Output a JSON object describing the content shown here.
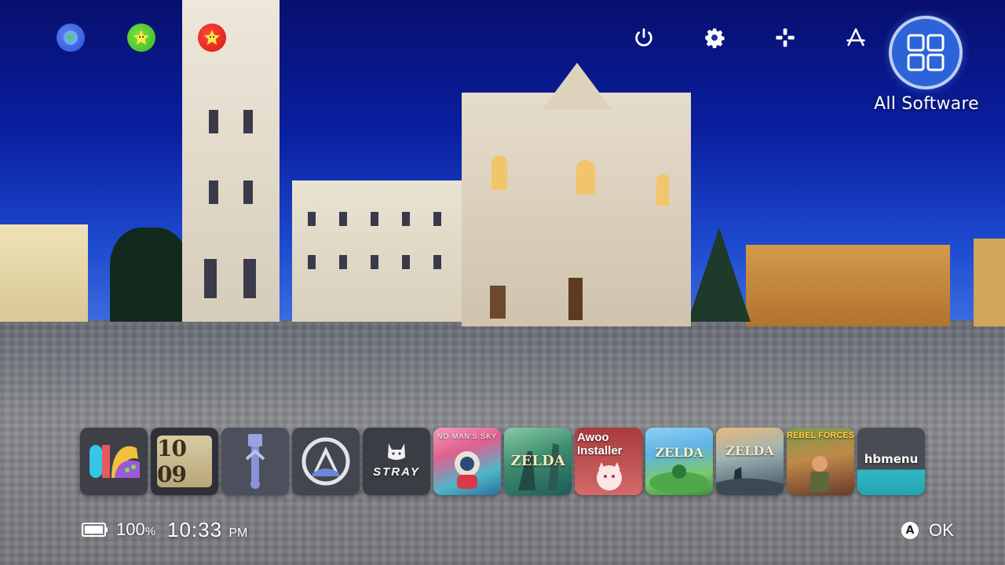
{
  "top_icons": [
    {
      "name": "globe-icon"
    },
    {
      "name": "green-star-icon"
    },
    {
      "name": "red-star-icon"
    }
  ],
  "system_icons": [
    "power-icon",
    "settings-gear-icon",
    "controllers-icon",
    "app-store-icon"
  ],
  "all_software": {
    "label": "All Software",
    "icon": "grid-icon",
    "ring_color": "#2c63d8"
  },
  "tiles": [
    {
      "id": "palette",
      "icon": "joycon-palette-icon"
    },
    {
      "id": "clock",
      "text": "10 09"
    },
    {
      "id": "usb",
      "icon": "usb-icon"
    },
    {
      "id": "cloud-sync",
      "icon": "sync-circle-icon"
    },
    {
      "id": "stray",
      "text": "STRAY"
    },
    {
      "id": "no-mans-sky",
      "text": "NO MAN'S SKY"
    },
    {
      "id": "zelda-1",
      "text": "ZELDA"
    },
    {
      "id": "awoo",
      "text": "Awoo Installer"
    },
    {
      "id": "zelda-2",
      "text": "ZELDA"
    },
    {
      "id": "zelda-3",
      "text": "ZELDA"
    },
    {
      "id": "rebel-forces",
      "text": "REBEL FORCES"
    },
    {
      "id": "hbmenu",
      "text": "hbmenu"
    }
  ],
  "status": {
    "battery_pct": "100",
    "battery_unit": "%",
    "time": "10:33",
    "ampm": "PM"
  },
  "footer": {
    "button": "A",
    "action": "OK"
  },
  "colors": {
    "sky": "#0a1fa0",
    "accent": "#2c63d8"
  }
}
